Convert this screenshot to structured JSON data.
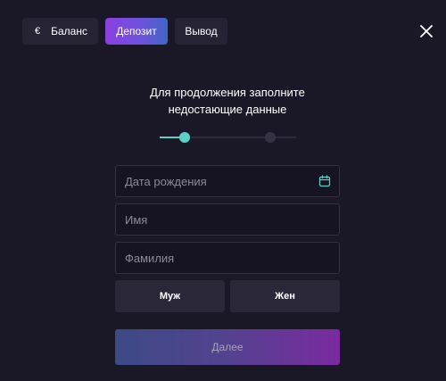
{
  "tabs": {
    "balance": {
      "currency_symbol": "€",
      "label": "Баланс"
    },
    "deposit": {
      "label": "Депозит"
    },
    "withdraw": {
      "label": "Вывод"
    }
  },
  "headline": {
    "line1": "Для продолжения заполните",
    "line2": "недостающие данные"
  },
  "stepper": {
    "current_step": 1,
    "total_steps": 2
  },
  "form": {
    "birth_date": {
      "placeholder": "Дата рождения",
      "value": ""
    },
    "first_name": {
      "placeholder": "Имя",
      "value": ""
    },
    "last_name": {
      "placeholder": "Фамилия",
      "value": ""
    },
    "gender_male_label": "Муж",
    "gender_female_label": "Жен",
    "next_label": "Далее"
  },
  "colors": {
    "background": "#1a1826",
    "accent_gradient_start": "#8a3fe0",
    "accent_gradient_end": "#3f67c6",
    "step_active": "#5ad1c4",
    "calendar_icon": "#5ad1c4"
  },
  "icons": {
    "close": "close-icon",
    "calendar": "calendar-icon"
  }
}
